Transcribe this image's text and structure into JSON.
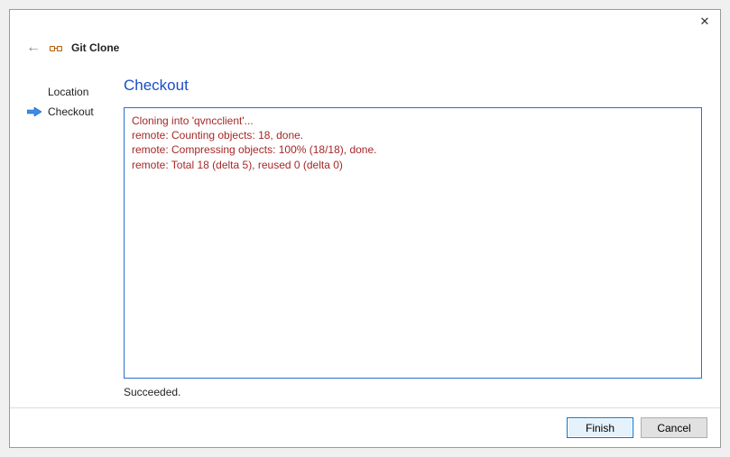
{
  "titlebar": {
    "close_glyph": "✕"
  },
  "header": {
    "back_glyph": "←",
    "title": "Git Clone"
  },
  "sidebar": {
    "items": [
      {
        "label": "Location",
        "active": false
      },
      {
        "label": "Checkout",
        "active": true
      }
    ]
  },
  "main": {
    "title": "Checkout",
    "log_lines": [
      "Cloning into 'qvncclient'...",
      "remote: Counting objects: 18, done.",
      "remote: Compressing objects: 100% (18/18), done.",
      "remote: Total 18 (delta 5), reused 0 (delta 0)"
    ],
    "status": "Succeeded."
  },
  "footer": {
    "finish_label": "Finish",
    "cancel_label": "Cancel"
  }
}
